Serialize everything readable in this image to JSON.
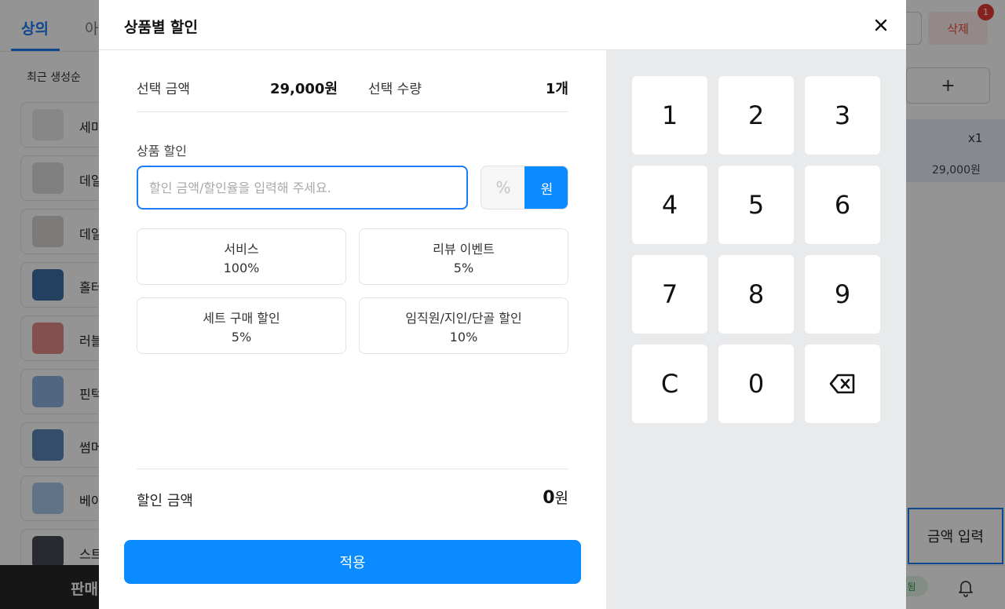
{
  "background": {
    "tabs": [
      "상의",
      "아"
    ],
    "sort_label": "최근 생성순",
    "products": [
      {
        "name": "세미",
        "color": "#e9e9e9"
      },
      {
        "name": "데일",
        "color": "#dcdcdc"
      },
      {
        "name": "데일",
        "color": "#d8d5d0"
      },
      {
        "name": "홀터",
        "color": "#3f6fa8"
      },
      {
        "name": "러블",
        "color": "#e48a86"
      },
      {
        "name": "핀턱",
        "color": "#8cb2df"
      },
      {
        "name": "썸머",
        "color": "#5b86b8"
      },
      {
        "name": "베이",
        "color": "#a7c7e8"
      },
      {
        "name": "스트",
        "color": "#444a55"
      }
    ],
    "bottom_left_label": "판매",
    "delete_label": "삭제",
    "badge_count": "1",
    "add_label": "+",
    "cart": {
      "qty": "x1",
      "price": "29,000원"
    },
    "amount_input_label": "금액 입력",
    "status_pill": "됨"
  },
  "modal": {
    "title": "상품별 할인",
    "selected_amount_label": "선택 금액",
    "selected_amount_value": "29,000원",
    "selected_qty_label": "선택 수량",
    "selected_qty_value": "1개",
    "discount_label": "상품 할인",
    "discount_placeholder": "할인 금액/할인율을 입력해 주세요.",
    "unit_percent": "%",
    "unit_won": "원",
    "presets": [
      {
        "name": "서비스",
        "value": "100%"
      },
      {
        "name": "리뷰 이벤트",
        "value": "5%"
      },
      {
        "name": "세트 구매 할인",
        "value": "5%"
      },
      {
        "name": "임직원/지인/단골 할인",
        "value": "10%"
      }
    ],
    "discount_total_label": "할인 금액",
    "discount_total_number": "0",
    "discount_total_unit": "원",
    "apply_label": "적용"
  },
  "keypad": {
    "keys": [
      "1",
      "2",
      "3",
      "4",
      "5",
      "6",
      "7",
      "8",
      "9",
      "C",
      "0"
    ],
    "backspace_icon": "backspace-icon"
  },
  "colors": {
    "accent": "#0a8bff",
    "delete_text": "#e84a3c",
    "badge": "#e53935"
  }
}
